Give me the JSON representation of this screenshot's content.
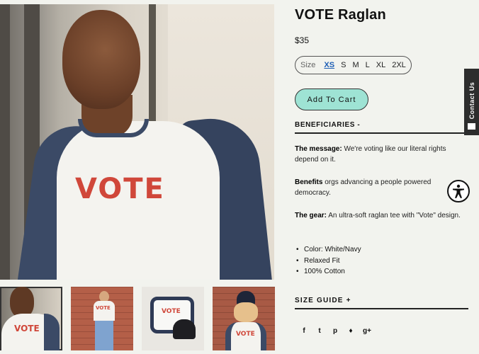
{
  "product": {
    "title": "VOTE Raglan",
    "price": "$35",
    "image_text": "VOTE",
    "size": {
      "label": "Size",
      "options": [
        "XS",
        "S",
        "M",
        "L",
        "XL",
        "2XL"
      ],
      "selected": "XS"
    },
    "add_to_cart": "Add To Cart"
  },
  "beneficiaries": {
    "heading": "BENEFICIARIES -",
    "message_label": "The message:",
    "message_text": "We're voting like our literal rights depend on it.",
    "benefits_label": "Benefits",
    "benefits_text": "orgs advancing a people powered democracy.",
    "gear_label": "The gear:",
    "gear_text": "An ultra-soft raglan tee with \"Vote\" design.",
    "bullets": [
      "Color: White/Navy",
      "Relaxed Fit",
      "100% Cotton"
    ]
  },
  "size_guide": "SIZE GUIDE +",
  "contact_tab": "Contact Us",
  "social_icons": [
    "facebook-icon",
    "twitter-icon",
    "pinterest-icon",
    "fancy-icon",
    "google-plus-icon"
  ],
  "social_glyphs": [
    "f",
    "t",
    "p",
    "♦",
    "g+"
  ],
  "colors": {
    "accent": "#9ee3d4",
    "selected_size": "#1f5fb5",
    "shirt_text": "#d0473a",
    "navy": "#3b4a66"
  }
}
